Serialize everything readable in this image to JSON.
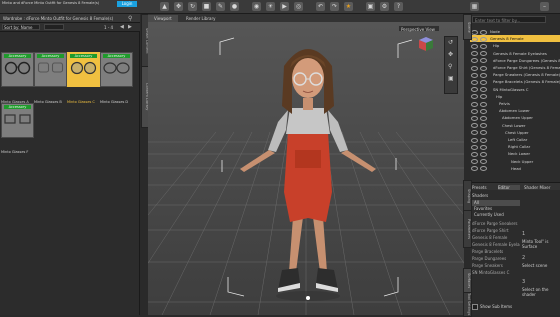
{
  "toolbar": {
    "login_label": "Login",
    "product_title": "Minto and dForce Minto Outfit for Genesis 8 Female(s)"
  },
  "content_library": {
    "path": "Wardrobe : dForce Minto Outfit for Genesis 8 Female(s)",
    "sort_label": "Sort by: Name",
    "page_indicator": "1 - 4",
    "badge_label": "Accessory",
    "items": [
      {
        "label": "Minto Glasses A",
        "selected": false
      },
      {
        "label": "Minto Glasses B",
        "selected": false
      },
      {
        "label": "Minto Glasses C",
        "selected": true
      },
      {
        "label": "Minto Glasses D",
        "selected": false
      },
      {
        "label": "Minto Glasses F",
        "selected": false
      }
    ]
  },
  "side_tabs_left": [
    "Smart Content",
    "Content Library"
  ],
  "viewport": {
    "tabs": [
      "Viewport",
      "Render Library"
    ],
    "view_selector": "Perspective View",
    "view_cube_icon": "view-cube-icon"
  },
  "scene": {
    "search_placeholder": "Enter text to filter by...",
    "nodes": [
      {
        "label": "Node",
        "level": 0,
        "highlight": false
      },
      {
        "label": "Genesis 8 Female",
        "level": 0,
        "highlight": true
      },
      {
        "label": "Hip",
        "level": 1,
        "highlight": false
      },
      {
        "label": "Genesis 8 Female Eyelashes",
        "level": 1,
        "highlight": false
      },
      {
        "label": "dForce Parge Dungarees (Genesis 8 Female)",
        "level": 1,
        "highlight": false
      },
      {
        "label": "dForce Parge Shirt (Genesis 8 Female)",
        "level": 1,
        "highlight": false
      },
      {
        "label": "Parge Sneakers (Genesis 8 Female)",
        "level": 1,
        "highlight": false
      },
      {
        "label": "Parge Bracelets (Genesis 8 Female)",
        "level": 1,
        "highlight": false
      },
      {
        "label": "SN MintoGlasses C",
        "level": 1,
        "highlight": false
      },
      {
        "label": "Hip",
        "level": 2,
        "highlight": false
      },
      {
        "label": "Pelvis",
        "level": 3,
        "highlight": false
      },
      {
        "label": "Abdomen Lower",
        "level": 3,
        "highlight": false
      },
      {
        "label": "Abdomen Upper",
        "level": 4,
        "highlight": false
      },
      {
        "label": "Chest Lower",
        "level": 4,
        "highlight": false
      },
      {
        "label": "Chest Upper",
        "level": 5,
        "highlight": false
      },
      {
        "label": "Left Collar",
        "level": 6,
        "highlight": false
      },
      {
        "label": "Right Collar",
        "level": 6,
        "highlight": false
      },
      {
        "label": "Neck Lower",
        "level": 6,
        "highlight": false
      },
      {
        "label": "Neck Upper",
        "level": 7,
        "highlight": false
      },
      {
        "label": "Head",
        "level": 7,
        "highlight": false
      }
    ]
  },
  "lower_tabs": [
    "Presets",
    "Editor",
    "Shader Mixer"
  ],
  "shaders": {
    "header": "Shaders",
    "filters": [
      "All",
      "Favorites",
      "Currently Used"
    ],
    "list": [
      "dForce Parge Sneakers",
      "dForce Parge Shirt",
      "Genesis 8 Female",
      "Genesis 8 Female Eyelashes",
      "Parge Bracelets",
      "Parge Dungarees",
      "Parge Sneakers",
      "SN MintoGlasses C"
    ],
    "show_sub_items": "Show Sub Items"
  },
  "tips": [
    {
      "num": "1",
      "text": "Minto Tool\" is Surface"
    },
    {
      "num": "2",
      "text": "Select scene"
    },
    {
      "num": "3",
      "text": "Select on the shader"
    }
  ],
  "side_tabs_right": [
    "Scene",
    "Shaping",
    "Parameters",
    "Surfaces",
    "Tool Settings"
  ],
  "colors": {
    "accessory_badge": "#1f9a2c",
    "selection_yellow": "#f0c040",
    "accent_orange": "#e8a01c",
    "login_blue": "#1aa1e0",
    "dungarees_red": "#c8402a"
  }
}
